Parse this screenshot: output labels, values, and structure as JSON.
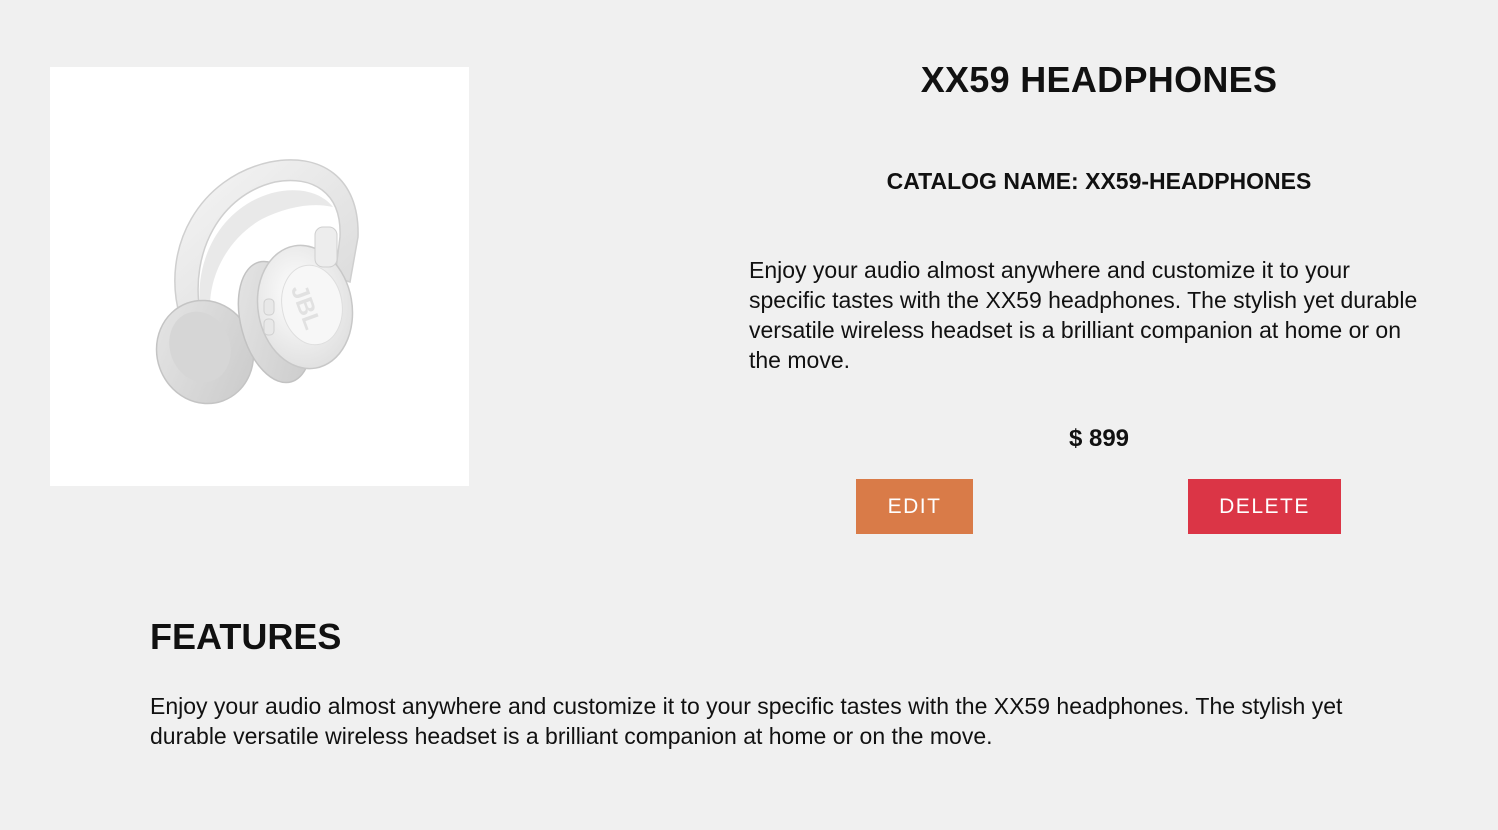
{
  "product": {
    "name": "XX59 HEADPHONES",
    "catalog_label": "CATALOG NAME: XX59-HEADPHONES",
    "description": "Enjoy your audio almost anywhere and customize it to your specific tastes with the XX59 headphones. The stylish yet durable versatile wireless headset is a brilliant companion at home or on the move.",
    "price": "$ 899",
    "image_brand": "JBL"
  },
  "actions": {
    "edit_label": "EDIT",
    "delete_label": "DELETE"
  },
  "features": {
    "heading": "FEATURES",
    "text": "Enjoy your audio almost anywhere and customize it to your specific tastes with the XX59 headphones. The stylish yet durable versatile wireless headset is a brilliant companion at home or on the move."
  },
  "colors": {
    "background": "#f0f0f0",
    "edit_button": "#d97b48",
    "delete_button": "#db3546"
  }
}
